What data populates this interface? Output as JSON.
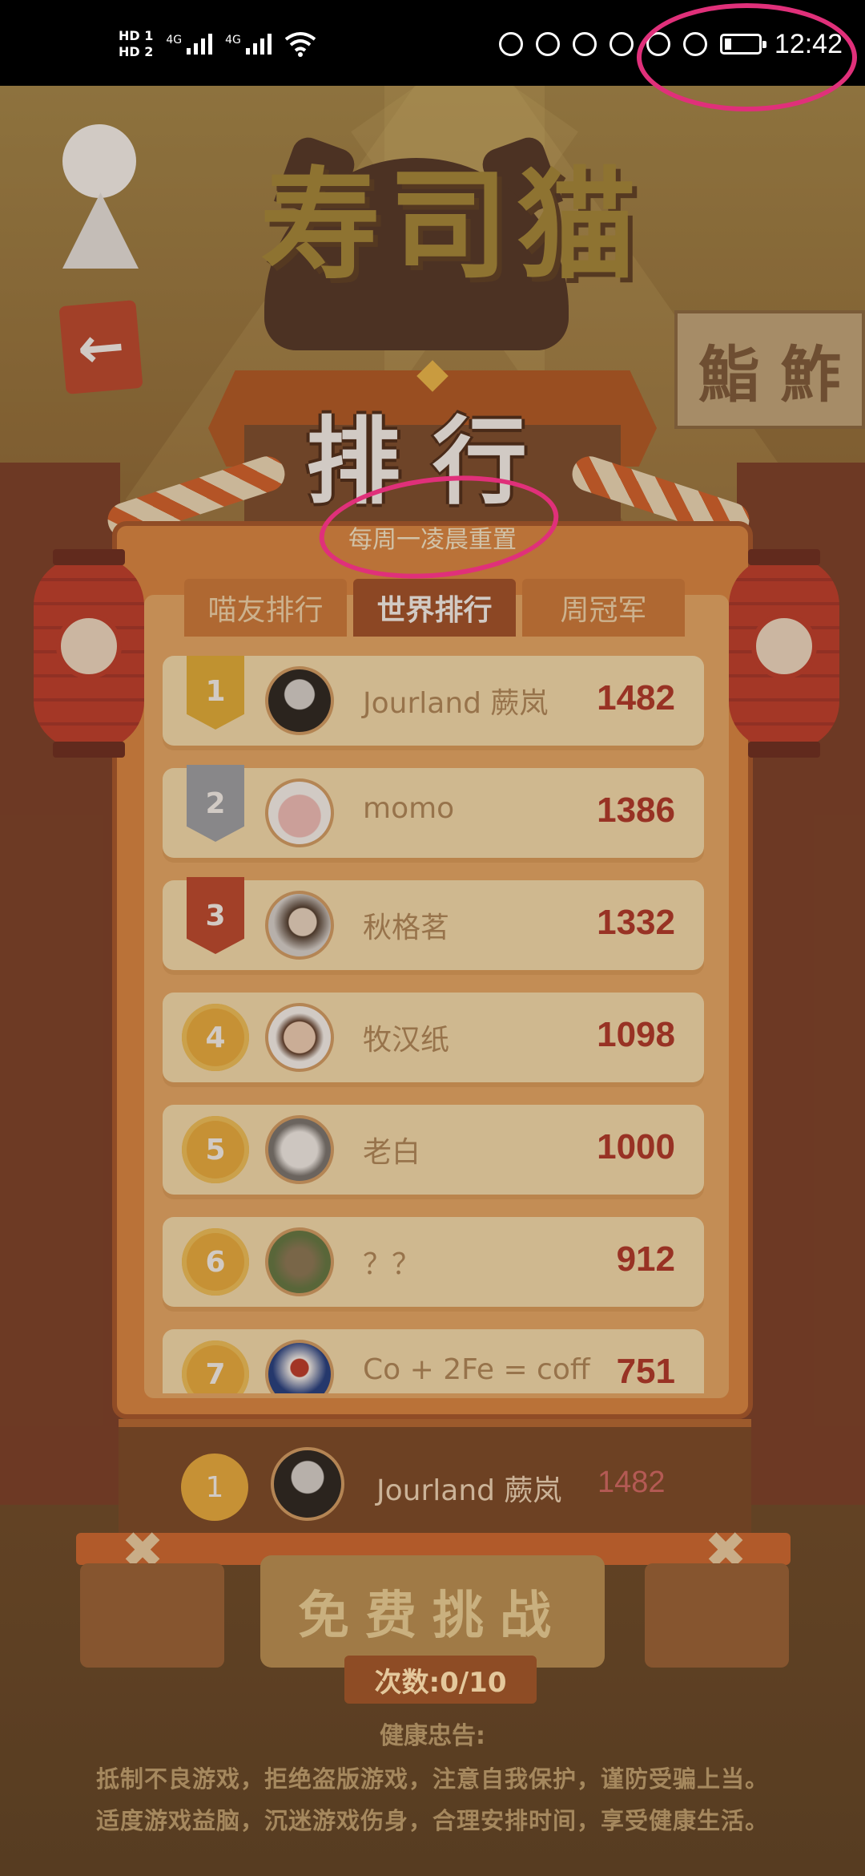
{
  "status_bar": {
    "hd1": "HD 1",
    "hd2": "HD 2",
    "net1": "4G",
    "net2": "4G",
    "time": "12:42",
    "battery_level": 0.2
  },
  "header": {
    "game_title": "寿司猫",
    "rank_title": "排行",
    "reset_note": "每周一凌晨重置",
    "sign_text": "鮨 鮓"
  },
  "tabs": [
    {
      "label": "喵友排行",
      "active": false
    },
    {
      "label": "世界排行",
      "active": true
    },
    {
      "label": "周冠军",
      "active": false
    }
  ],
  "ranking": [
    {
      "rank": "1",
      "name": "Jourland 蕨岚",
      "score": "1482"
    },
    {
      "rank": "2",
      "name": "momo",
      "score": "1386"
    },
    {
      "rank": "3",
      "name": "秋格茗",
      "score": "1332"
    },
    {
      "rank": "4",
      "name": "牧汉纸",
      "score": "1098"
    },
    {
      "rank": "5",
      "name": "老白",
      "score": "1000"
    },
    {
      "rank": "6",
      "name": "？？",
      "score": "912"
    },
    {
      "rank": "7",
      "name": "Co + 2Fe = coff",
      "score": "751"
    }
  ],
  "my_rank": {
    "rank": "1",
    "name": "Jourland 蕨岚",
    "score": "1482"
  },
  "footer": {
    "challenge_label": "免费挑战",
    "count_label": "次数:0/10",
    "notice_title": "健康忠告:",
    "notice_line1": "抵制不良游戏，拒绝盗版游戏，注意自我保护，谨防受骗上当。",
    "notice_line2": "适度游戏益脑，沉迷游戏伤身，合理安排时间，享受健康生活。"
  },
  "colors": {
    "badge_gold": "#e9b53a",
    "badge_silver": "#9ea6b0",
    "badge_bronze": "#c1472f",
    "score_red": "#b3342a",
    "annotation_pink": "#e0307a"
  }
}
